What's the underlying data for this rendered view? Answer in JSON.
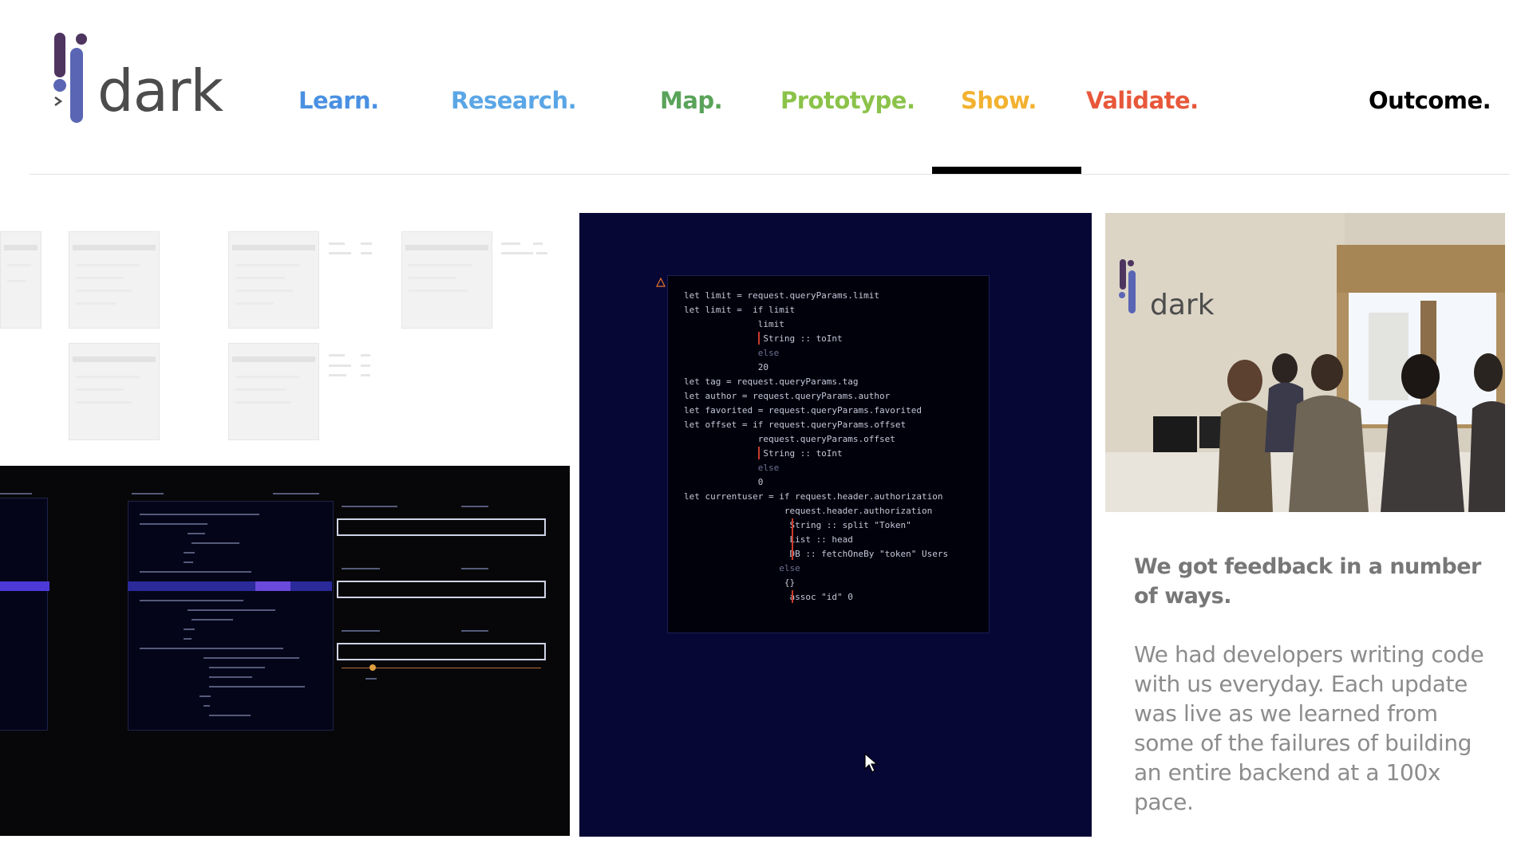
{
  "brand": {
    "name": "dark"
  },
  "nav": {
    "items": [
      {
        "label": "Learn.",
        "color": "#4a90e2"
      },
      {
        "label": "Research.",
        "color": "#5aa6e6"
      },
      {
        "label": "Map.",
        "color": "#5aa35a"
      },
      {
        "label": "Prototype.",
        "color": "#8bc34a"
      },
      {
        "label": "Show.",
        "color": "#f2b230"
      },
      {
        "label": "Validate.",
        "color": "#e8573a"
      },
      {
        "label": "Outcome.",
        "color": "#000000"
      }
    ],
    "active": "Show."
  },
  "code_panel": {
    "lines": [
      "let limit = request.queryParams.limit",
      "let limit =  if limit",
      "              limit",
      "               String :: toInt",
      "              else",
      "              20",
      "let tag = request.queryParams.tag",
      "let author = request.queryParams.author",
      "let favorited = request.queryParams.favorited",
      "let offset = if request.queryParams.offset",
      "              request.queryParams.offset",
      "               String :: toInt",
      "              else",
      "              0",
      "let currentuser = if request.header.authorization",
      "                   request.header.authorization",
      "                    String :: split \"Token\"",
      "                    List :: head",
      "                    DB :: fetchOneBy \"token\" Users",
      "                  else",
      "                   {}",
      "                    assoc \"id\" 0"
    ]
  },
  "photo": {
    "logo_text": "dark"
  },
  "card": {
    "heading": "We got feedback in a number of ways.",
    "body": "We had developers writing code with us everyday. Each update was live as we learned from some of the failures of building an entire backend at a 100x pace."
  },
  "colors": {
    "code_bg": "#060735",
    "editor_bg": "#070709",
    "accent_bar": "#c93b2a"
  }
}
